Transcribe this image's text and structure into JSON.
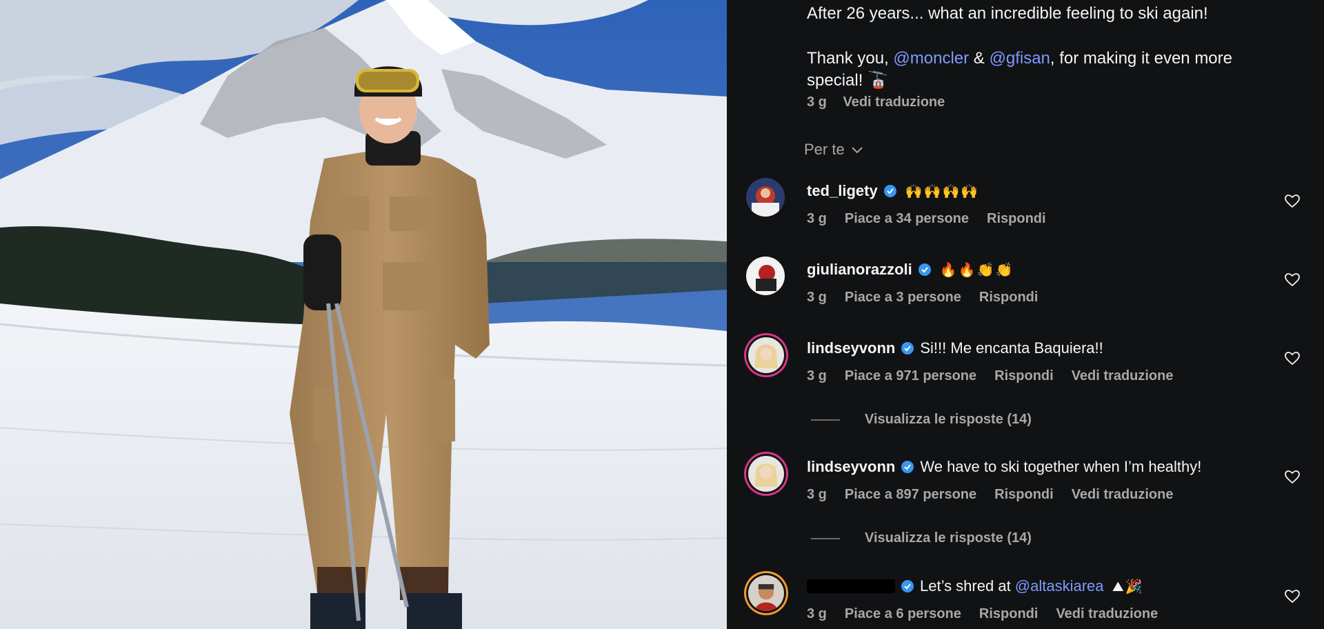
{
  "post": {
    "caption_line1": "After 26 years... what an incredible feeling to ski again!",
    "caption_line2_pre": "Thank you, ",
    "mention1": "@moncler",
    "caption_amp": " & ",
    "mention2": "@gfisan",
    "caption_line2_post": ", for making it even more",
    "caption_line3": "special! 🚡",
    "time": "3 g",
    "translate": "Vedi traduzione"
  },
  "sort": {
    "label": "Per te"
  },
  "comments": [
    {
      "username": "ted_ligety",
      "text": "🙌🙌🙌🙌",
      "time": "3 g",
      "likes": "Piace a 34 persone",
      "reply": "Rispondi",
      "translate": ""
    },
    {
      "username": "giulianorazzoli",
      "text": "🔥🔥👏👏",
      "time": "3 g",
      "likes": "Piace a 3 persone",
      "reply": "Rispondi",
      "translate": ""
    },
    {
      "username": "lindseyvonn",
      "text": "Si!!! Me encanta Baquiera!!",
      "time": "3 g",
      "likes": "Piace a 971 persone",
      "reply": "Rispondi",
      "translate": "Vedi traduzione",
      "view_replies": "Visualizza le risposte (14)"
    },
    {
      "username": "lindseyvonn",
      "text": "We have to ski together when I’m healthy!",
      "time": "3 g",
      "likes": "Piace a 897 persone",
      "reply": "Rispondi",
      "translate": "Vedi traduzione",
      "view_replies": "Visualizza le risposte (14)"
    },
    {
      "username": "",
      "text_pre": "Let’s shred at ",
      "mention": "@altaskiarea",
      "text_post": " ⛰🎉",
      "time": "3 g",
      "likes": "Piace a 6 persone",
      "reply": "Rispondi",
      "translate": "Vedi traduzione"
    }
  ],
  "colors": {
    "panel_bg": "#111214",
    "mention": "#7d9bff",
    "verified": "#3897f0",
    "meta": "#a8a8a8"
  },
  "icons": [
    "verified-badge-icon",
    "heart-outline-icon",
    "chevron-down-icon"
  ]
}
